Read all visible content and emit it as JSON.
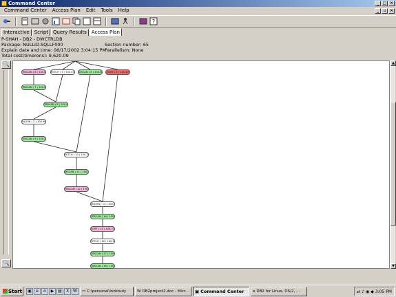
{
  "window": {
    "title": "Command Center"
  },
  "menu": [
    "Command Center",
    "Access Plan",
    "Edit",
    "Tools",
    "Help"
  ],
  "toolbar": {
    "icons": [
      "connect-icon",
      "script-icon",
      "object-icon",
      "list-icon",
      "chart-icon",
      "doc-icon",
      "copy-icon",
      "grid-icon",
      "table-icon",
      "replication-icon",
      "db-icon",
      "help-icon"
    ],
    "help_label": "?"
  },
  "tabs": [
    "Interactive",
    "Script",
    "Query Results",
    "Access Plan"
  ],
  "info": {
    "line1": "P-SHAH - DB2 - DWCTRLDB",
    "package": "Package: NULLID.SQLLF000",
    "section": "Section number: 65",
    "explain": "Explain date and time: 08/17/2002 3:04:15 PM",
    "parallelism": "Parallelism: None",
    "cost": "Total cost(timerons): 9,620.09"
  },
  "plan_nodes": [
    {
      "label": "TBSCAN ( 6 ) 100.07",
      "kind": "scan"
    },
    {
      "label": "FETCH ( 3 ) 100.50",
      "kind": "operator"
    },
    {
      "label": "IXSCAN ( 4 ) 100.08",
      "kind": "index"
    },
    {
      "label": "SORT ( 5 ) 100.42",
      "kind": "sort"
    },
    {
      "label": "TBSCAN ( 7 ) 100.06",
      "kind": "index"
    },
    {
      "label": "TBSCAN ( 8 ) 100.09",
      "kind": "index"
    },
    {
      "label": "NLJOIN ( 2 ) 100.96",
      "kind": "join"
    },
    {
      "label": "TBSCAN ( 9 ) 100.27",
      "kind": "index"
    },
    {
      "label": "FETCH ( 10 ) 100.25",
      "kind": "operator"
    },
    {
      "label": "IXSCAN ( 11 ) 100.08",
      "kind": "index"
    },
    {
      "label": "TBSCAN ( 12 ) 100.16",
      "kind": "scan"
    },
    {
      "label": "MSJOIN ( 13 ) 100.50",
      "kind": "join"
    },
    {
      "label": "TBSCAN ( 14 ) 100.10",
      "kind": "index"
    },
    {
      "label": "SORT ( 15 ) 100.73",
      "kind": "scan"
    },
    {
      "label": "FETCH ( 16 ) 100.30",
      "kind": "join"
    },
    {
      "label": "TBSCAN ( 17 ) 100.07",
      "kind": "index"
    },
    {
      "label": "TBSCAN ( 18 ) 100.07",
      "kind": "index"
    },
    {
      "label": "TBSCAN ( 19 ) 100.07",
      "kind": "index"
    },
    {
      "label": "NLJOIN ( 20 ) 100.14",
      "kind": "scan"
    }
  ],
  "taskbar": {
    "start": "Start",
    "tasks": [
      "C:\\personal\\indstudy",
      "DB2project2.doc - Micr...",
      "Command Center",
      "DB2 for Linux, OS/2, ..."
    ],
    "time": "3:05 PM"
  }
}
